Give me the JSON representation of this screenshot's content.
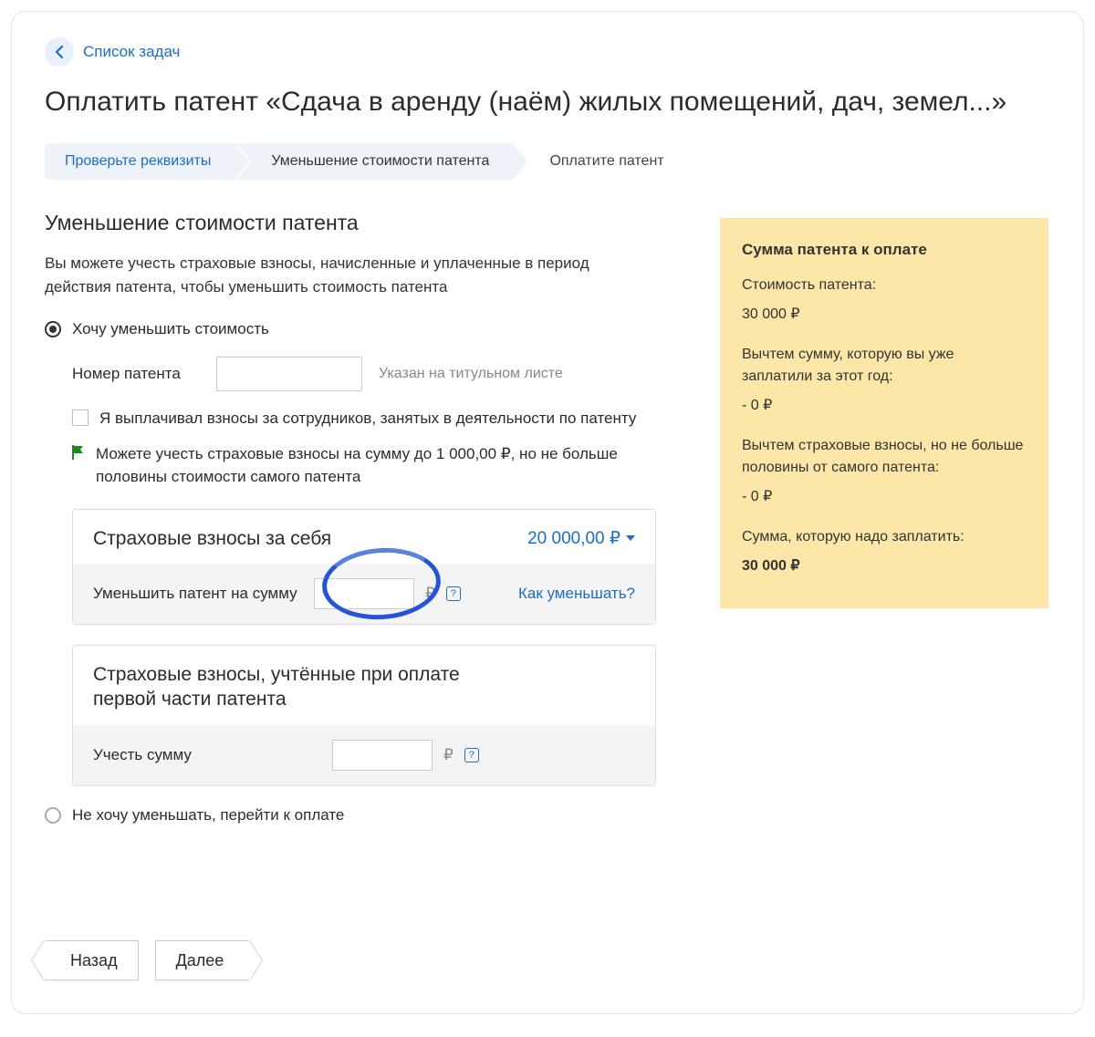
{
  "nav": {
    "back_label": "Список задач"
  },
  "title": "Оплатить патент «Сдача в аренду (наём) жилых помещений, дач, земел...»",
  "steps": {
    "s1": "Проверьте реквизиты",
    "s2": "Уменьшение стоимости патента",
    "s3": "Оплатите патент"
  },
  "section": {
    "heading": "Уменьшение стоимости патента",
    "desc": "Вы можете учесть страховые взносы, начисленные и уплаченные в период действия патента, чтобы уменьшить стоимость патента"
  },
  "option_reduce": "Хочу уменьшить стоимость",
  "option_skip": "Не хочу уменьшать, перейти к оплате",
  "patent_number_label": "Номер патента",
  "patent_number_hint": "Указан на титульном листе",
  "employee_check": "Я выплачивал взносы за сотрудников, занятых в деятельности по патенту",
  "flag_text": "Можете учесть страховые взносы на сумму до 1 000,00 ₽, но не больше половины стоимости самого патента",
  "card1": {
    "title": "Страховые взносы за себя",
    "amount": "20 000,00 ₽",
    "body_label": "Уменьшить патент на сумму",
    "how_link": "Как уменьшать?"
  },
  "card2": {
    "title": "Страховые взносы, учтённые при оплате первой части патента",
    "body_label": "Учесть сумму"
  },
  "ruble": "₽",
  "help_q": "?",
  "summary": {
    "title": "Сумма патента к оплате",
    "cost_label": "Стоимость патента:",
    "cost_value": "30 000 ₽",
    "paid_label": "Вычтем сумму, которую вы уже заплатили за этот год:",
    "paid_value": "- 0 ₽",
    "ins_label": "Вычтем страховые взносы, но не больше половины от самого патента:",
    "ins_value": "- 0 ₽",
    "total_label": "Сумма, которую надо заплатить:",
    "total_value": "30 000 ₽"
  },
  "buttons": {
    "back": "Назад",
    "next": "Далее"
  }
}
